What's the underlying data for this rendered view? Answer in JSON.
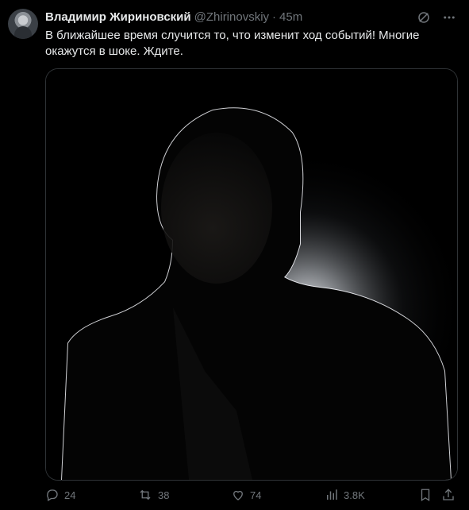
{
  "tweet": {
    "author_name": "Владимир Жириновский",
    "handle": "@Zhirinovskiy",
    "separator": "·",
    "time": "45m",
    "text": "В ближайшее время случится то, что изменит ход событий! Многие окажутся в шоке. Ждите."
  },
  "actions": {
    "replies": "24",
    "reposts": "38",
    "likes": "74",
    "views": "3.8K"
  },
  "icons": [
    "grok-icon",
    "more-icon",
    "reply-icon",
    "repost-icon",
    "like-icon",
    "views-icon",
    "bookmark-icon",
    "share-icon"
  ],
  "colors": {
    "background": "#000000",
    "text": "#e7e9ea",
    "muted": "#71767b",
    "border": "#2f3336"
  }
}
